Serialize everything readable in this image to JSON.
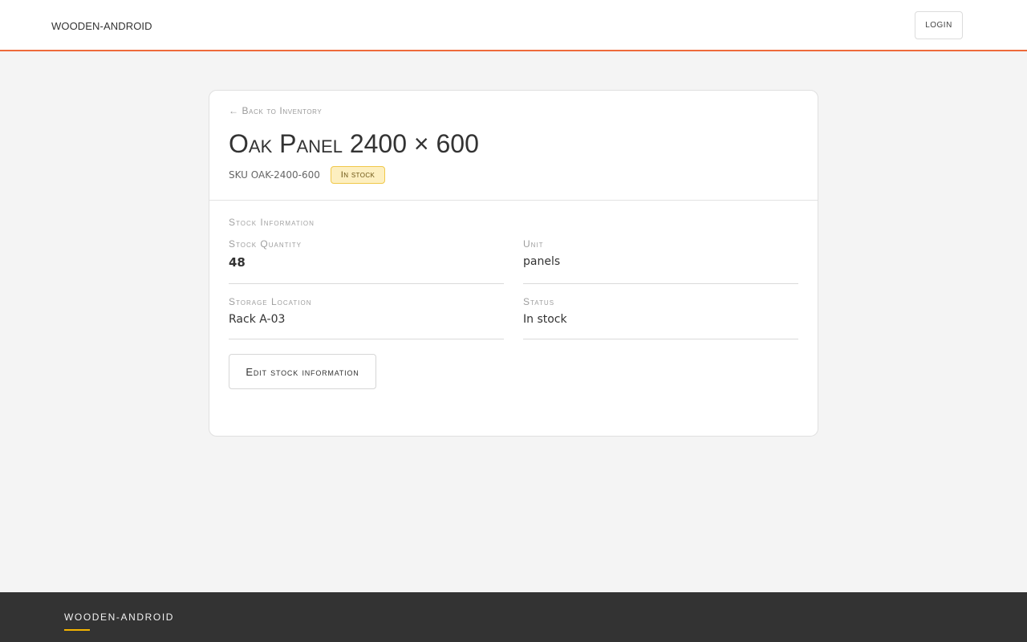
{
  "header": {
    "brand": "WOODEN-ANDROID",
    "login_label": "LOGIN"
  },
  "item": {
    "back_link": "← Back to Inventory",
    "title": "Oak Panel 2400 × 600",
    "sku": "SKU OAK-2400-600",
    "status_badge": "In stock"
  },
  "stock_info": {
    "section_title": "Stock Information",
    "fields": [
      {
        "label": "Stock Quantity",
        "value": "48"
      },
      {
        "label": "Unit",
        "value": "panels"
      },
      {
        "label": "Storage Location",
        "value": "Rack A-03"
      },
      {
        "label": "Status",
        "value": "In stock"
      }
    ],
    "edit_label": "Edit stock information"
  },
  "footer": {
    "brand": "WOODEN-ANDROID"
  },
  "colors": {
    "accent_orange": "#ee6a3a",
    "badge_bg": "#fdefc0",
    "badge_border": "#f0c84a",
    "footer_bg": "#333333",
    "footer_accent": "#f5b400"
  }
}
